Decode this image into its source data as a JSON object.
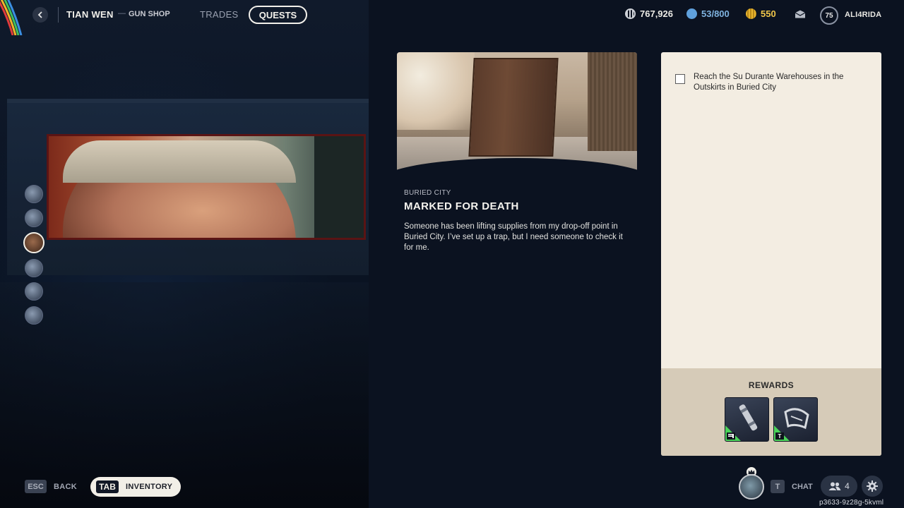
{
  "topbar": {
    "vendor_name": "TIAN WEN",
    "vendor_dash": "—",
    "vendor_role": "GUN SHOP",
    "tabs": [
      {
        "label": "TRADES",
        "active": false
      },
      {
        "label": "QUESTS",
        "active": true
      }
    ],
    "stats": {
      "coins": "767,926",
      "capacity": "53/800",
      "credits": "550"
    },
    "player_level": "75",
    "username": "ALI4RIDA"
  },
  "npc_list": {
    "selected_index": 2,
    "count": 6
  },
  "quest": {
    "location": "BURIED CITY",
    "title": "MARKED FOR DEATH",
    "description": "Someone has been lifting supplies from my drop-off point in Buried City. I’ve set up a trap, but I need someone to check it for me."
  },
  "objectives": [
    {
      "text": "Reach the Su Durante Warehouses in the Outskirts in Buried City",
      "done": false
    }
  ],
  "rewards": {
    "title": "REWARDS",
    "items": [
      {
        "icon": "canister-icon",
        "tag_icon": "ammo-tag-icon",
        "rarity_color": "#4bd35a"
      },
      {
        "icon": "crossbow-part-icon",
        "tag": "T",
        "rarity_color": "#4bd35a"
      }
    ]
  },
  "bottombar": {
    "esc_key": "ESC",
    "back_label": "BACK",
    "tab_key": "TAB",
    "inventory_label": "INVENTORY",
    "chat_key": "T",
    "chat_label": "CHAT",
    "party_count": "4",
    "session_id": "p3633-9z28g-5kvml"
  },
  "colors": {
    "background": "#0b1220",
    "panel": "#f3ede2",
    "rewards_bg": "#d6cbb8",
    "credits": "#f0c64a",
    "capacity": "#7fb3e0",
    "rarity_green": "#4bd35a"
  }
}
